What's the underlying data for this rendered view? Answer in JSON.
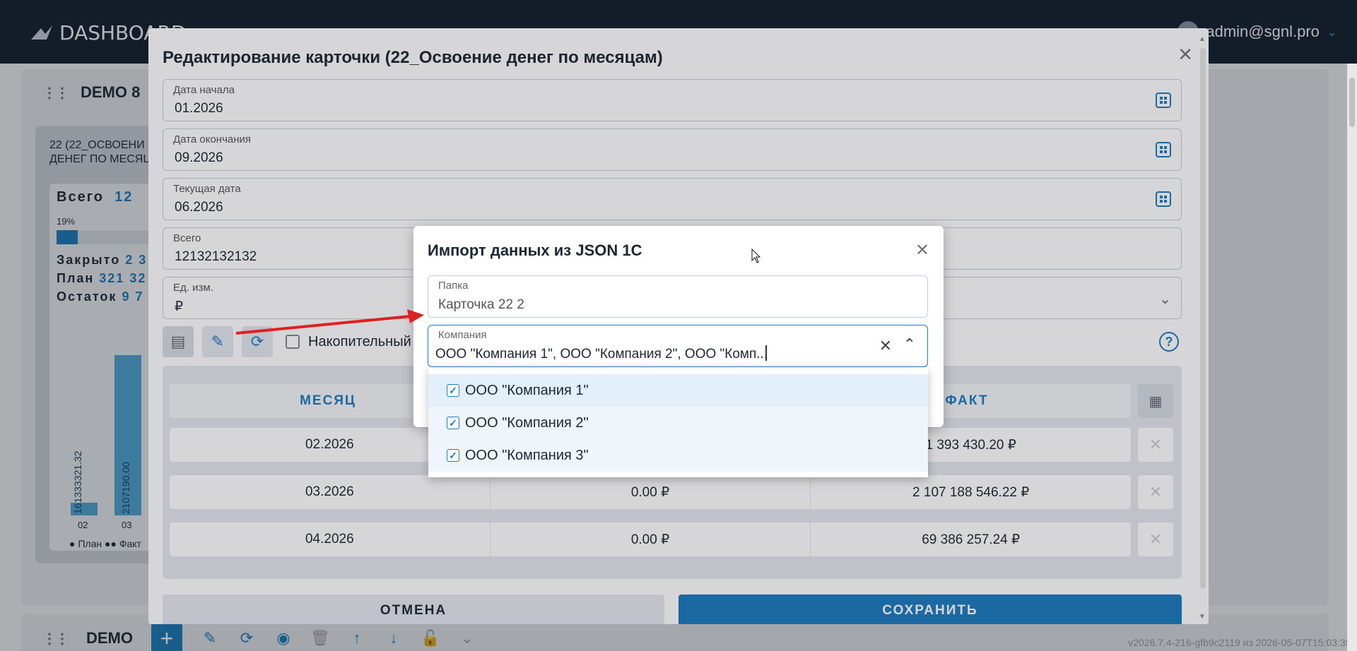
{
  "app": {
    "logo_text": "DASHBOARD",
    "user_email": "admin@sgnl.pro"
  },
  "board": {
    "title": "DEMO 8",
    "widget": {
      "title_line1": "22 (22_ОСВОЕНИ",
      "title_line2": "ДЕНЕГ ПО МЕСЯЦ",
      "total_label": "Всего",
      "total_value": "12",
      "percent": "19%",
      "progress": 0.19,
      "closed_label": "Закрыто",
      "closed_value": "2 3",
      "plan_label": "План",
      "plan_value": "321 32",
      "rest_label": "Остаток",
      "rest_value": "9 7",
      "bar1_label": "161333321.32",
      "bar2_label": "2107190.00",
      "x1": "02",
      "x2": "03",
      "legend_plan": "План",
      "legend_fact": "Факт"
    },
    "bottom_title": "DEMO",
    "version": "v2026.7.4-216-gfb9c2119 из 2026-05-07T15:03:35Z"
  },
  "edit_modal": {
    "title": "Редактирование карточки (22_Освоение денег по месяцам)",
    "fields": {
      "start_label": "Дата начала",
      "start_value": "01.2026",
      "end_label": "Дата окончания",
      "end_value": "09.2026",
      "current_label": "Текущая дата",
      "current_value": "06.2026",
      "total_label": "Всего",
      "total_value": "12132132132",
      "unit_label": "Ед. изм.",
      "unit_value": "₽"
    },
    "cumulative_label": "Накопительный",
    "table": {
      "headers": [
        "МЕСЯЦ",
        "",
        "ФАКТ"
      ],
      "rows": [
        {
          "month": "02.2026",
          "plan": "",
          "fact": "1 393 430.20 ₽"
        },
        {
          "month": "03.2026",
          "plan": "0.00 ₽",
          "fact": "2 107 188 546.22 ₽"
        },
        {
          "month": "04.2026",
          "plan": "0.00 ₽",
          "fact": "69 386 257.24 ₽"
        }
      ]
    },
    "cancel_label": "ОТМЕНА",
    "save_label": "СОХРАНИТЬ"
  },
  "import_dialog": {
    "title": "Импорт данных из JSON 1С",
    "folder_label": "Папка",
    "folder_value": "Карточка 22 2",
    "company_label": "Компания",
    "company_value": "ООО \"Компания 1\", ООО \"Компания 2\", ООО \"Комп...",
    "options": [
      {
        "label": "ООО \"Компания 1\"",
        "checked": true
      },
      {
        "label": "ООО \"Компания 2\"",
        "checked": true
      },
      {
        "label": "ООО \"Компания 3\"",
        "checked": true
      }
    ]
  },
  "colors": {
    "accent": "#1a7bbf",
    "topbar": "#0f1d2c"
  }
}
